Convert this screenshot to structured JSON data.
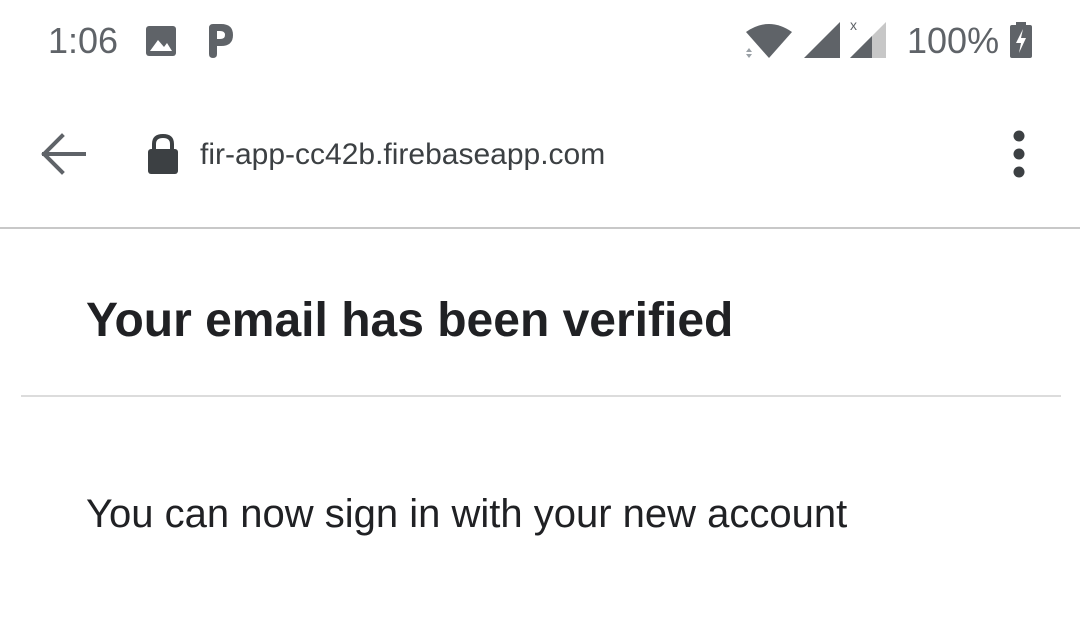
{
  "status_bar": {
    "time": "1:06",
    "battery_level": "100%",
    "icons": [
      "image-notification-icon",
      "parking-app-icon",
      "wifi-icon",
      "cell-signal-icon",
      "cell-signal-no-data-icon",
      "battery-charging-icon"
    ],
    "icon_color": "#5f6368"
  },
  "toolbar": {
    "url": "fir-app-cc42b.firebaseapp.com",
    "icons": [
      "back-arrow-icon",
      "lock-icon",
      "more-vert-icon"
    ]
  },
  "page": {
    "title": "Your email has been verified",
    "message": "You can now sign in with your new account"
  },
  "colors": {
    "text_primary": "#202124",
    "text_secondary": "#5f6368",
    "divider": "#dcdcdc"
  }
}
